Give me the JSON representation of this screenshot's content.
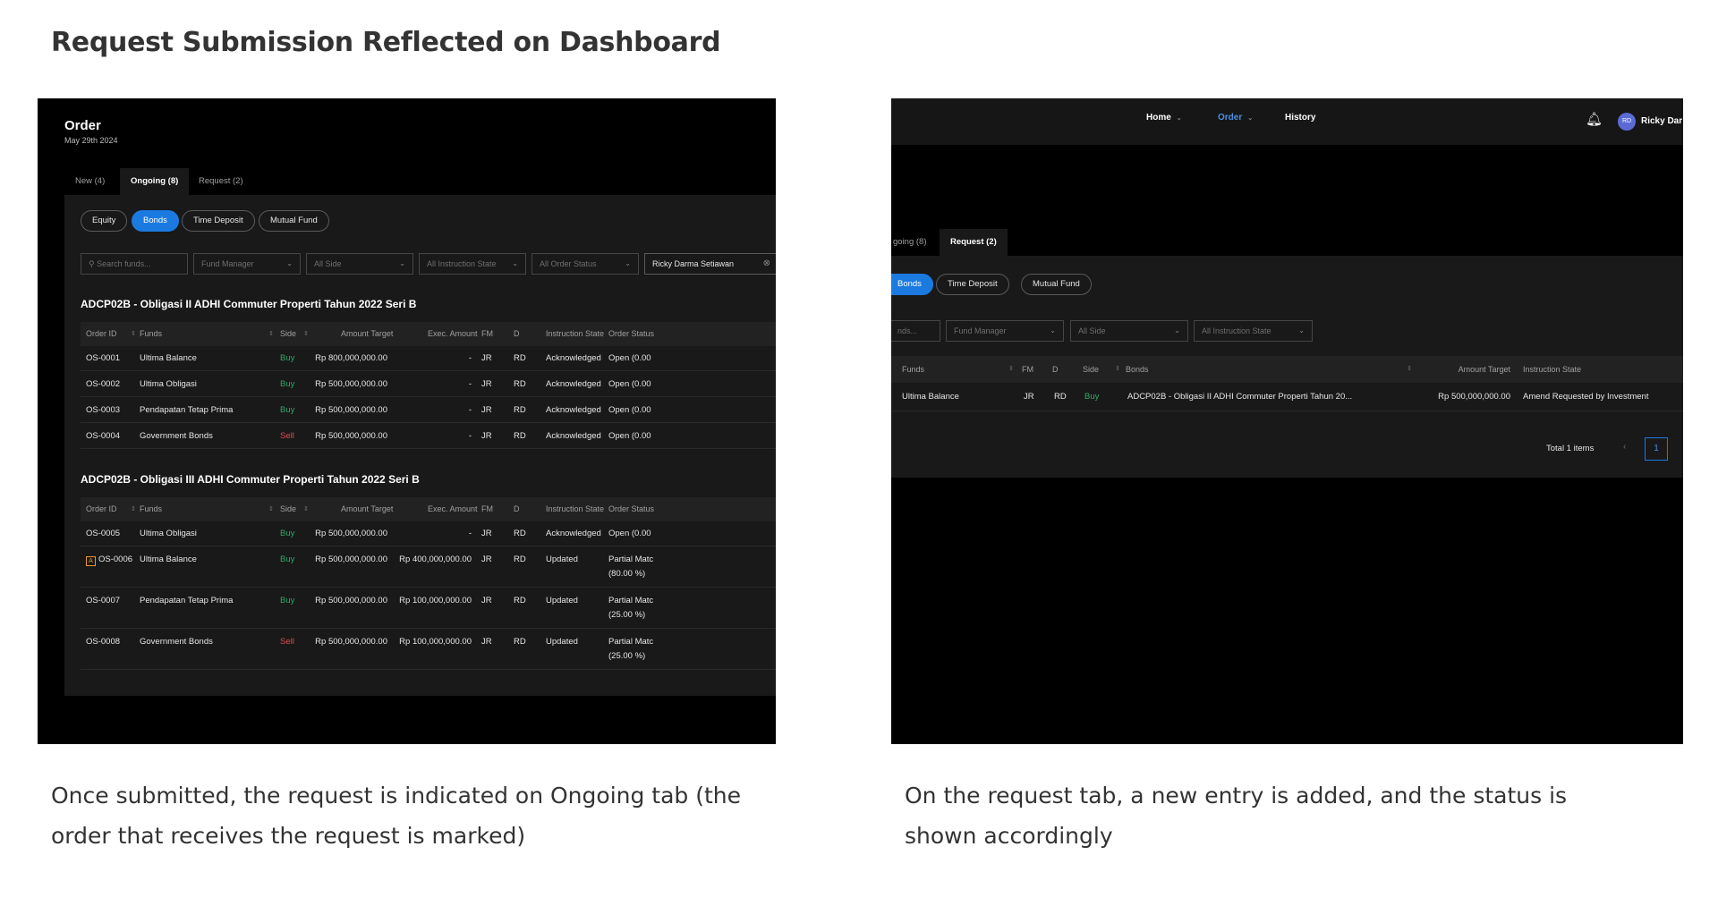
{
  "page": {
    "title": "Request Submission Reflected on Dashboard",
    "left_caption": "Once submitted, the request is indicated on Ongoing tab (the order that receives the request is marked)",
    "right_caption": "On the request tab, a new entry is added, and the status is shown accordingly"
  },
  "colors": {
    "accent": "#1a7ae0",
    "buy": "#2fa86a",
    "sell": "#e04b4b",
    "flag": "#e8962a",
    "panel_bg": "#000000",
    "card_bg": "#191919"
  },
  "left": {
    "title": "Order",
    "date": "May 29th 2024",
    "tabs": [
      "New (4)",
      "Ongoing (8)",
      "Request (2)"
    ],
    "pills": [
      "Equity",
      "Bonds",
      "Time Deposit",
      "Mutual Fund"
    ],
    "filters": {
      "search_placeholder": "Search funds...",
      "fund_manager": "Fund Manager",
      "side": "All Side",
      "instruction_state": "All Instruction State",
      "order_status": "All Order Status",
      "user": "Ricky Darma Setiawan"
    },
    "headers": [
      "Order ID",
      "Funds",
      "Side",
      "Amount Target",
      "Exec. Amount",
      "FM",
      "D",
      "Instruction State",
      "Order Status"
    ],
    "sections": [
      {
        "title": "ADCP02B - Obligasi II ADHI Commuter Properti Tahun 2022 Seri B",
        "rows": [
          {
            "id": "OS-0001",
            "fund": "Ultima Balance",
            "side": "Buy",
            "target": "Rp 800,000,000.00",
            "exec": "-",
            "fm": "JR",
            "d": "RD",
            "state": "Acknowledged",
            "status": "Open (0.00",
            "status2": ""
          },
          {
            "id": "OS-0002",
            "fund": "Ultima Obligasi",
            "side": "Buy",
            "target": "Rp 500,000,000.00",
            "exec": "-",
            "fm": "JR",
            "d": "RD",
            "state": "Acknowledged",
            "status": "Open (0.00",
            "status2": ""
          },
          {
            "id": "OS-0003",
            "fund": "Pendapatan Tetap Prima",
            "side": "Buy",
            "target": "Rp 500,000,000.00",
            "exec": "-",
            "fm": "JR",
            "d": "RD",
            "state": "Acknowledged",
            "status": "Open (0.00",
            "status2": ""
          },
          {
            "id": "OS-0004",
            "fund": "Government Bonds",
            "side": "Sell",
            "target": "Rp 500,000,000.00",
            "exec": "-",
            "fm": "JR",
            "d": "RD",
            "state": "Acknowledged",
            "status": "Open (0.00",
            "status2": ""
          }
        ]
      },
      {
        "title": "ADCP02B - Obligasi III ADHI Commuter Properti Tahun 2022 Seri B",
        "rows": [
          {
            "id": "OS-0005",
            "fund": "Ultima Obligasi",
            "side": "Buy",
            "target": "Rp 500,000,000.00",
            "exec": "-",
            "fm": "JR",
            "d": "RD",
            "state": "Acknowledged",
            "status": "Open (0.00",
            "status2": ""
          },
          {
            "id": "OS-0006",
            "flag": "A",
            "fund": "Ultima Balance",
            "side": "Buy",
            "target": "Rp 500,000,000.00",
            "exec": "Rp 400,000,000.00",
            "fm": "JR",
            "d": "RD",
            "state": "Updated",
            "status": "Partial Matc",
            "status2": "(80.00 %)"
          },
          {
            "id": "OS-0007",
            "fund": "Pendapatan Tetap Prima",
            "side": "Buy",
            "target": "Rp 500,000,000.00",
            "exec": "Rp 100,000,000.00",
            "fm": "JR",
            "d": "RD",
            "state": "Updated",
            "status": "Partial Matc",
            "status2": "(25.00 %)"
          },
          {
            "id": "OS-0008",
            "fund": "Government Bonds",
            "side": "Sell",
            "target": "Rp 500,000,000.00",
            "exec": "Rp 100,000,000.00",
            "fm": "JR",
            "d": "RD",
            "state": "Updated",
            "status": "Partial Matc",
            "status2": "(25.00 %)"
          }
        ]
      }
    ]
  },
  "right": {
    "nav": [
      "Home",
      "Order",
      "History"
    ],
    "user_initials": "RD",
    "user_name": "Ricky Dar",
    "tabs": [
      "going (8)",
      "Request (2)"
    ],
    "pills": [
      "Bonds",
      "Time Deposit",
      "Mutual Fund"
    ],
    "filters": {
      "search_placeholder": "nds...",
      "fund_manager": "Fund Manager",
      "side": "All Side",
      "instruction_state": "All Instruction State"
    },
    "headers": [
      "Funds",
      "FM",
      "D",
      "Side",
      "Bonds",
      "Amount Target",
      "Instruction State"
    ],
    "row": {
      "fund": "Ultima Balance",
      "fm": "JR",
      "d": "RD",
      "side": "Buy",
      "bond": "ADCP02B - Obligasi II ADHI Commuter Properti Tahun 20...",
      "target": "Rp 500,000,000.00",
      "state": "Amend Requested by Investment"
    },
    "total": "Total 1 items",
    "page": "1"
  }
}
